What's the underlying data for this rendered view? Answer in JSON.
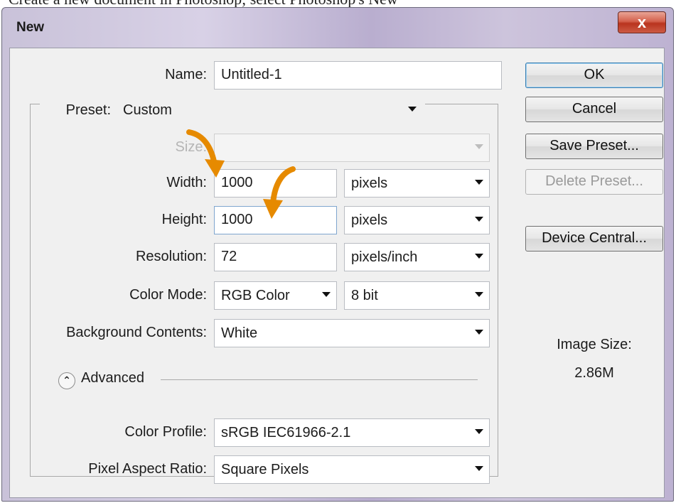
{
  "header_text": "Create a new document in Photoshop; select Photoshop's New",
  "window": {
    "title": "New",
    "close_glyph": "x"
  },
  "form": {
    "name": {
      "label": "Name:",
      "value": "Untitled-1"
    },
    "preset": {
      "label": "Preset:",
      "value": "Custom"
    },
    "size": {
      "label": "Size:",
      "value": ""
    },
    "width": {
      "label": "Width:",
      "value": "1000",
      "unit": "pixels"
    },
    "height": {
      "label": "Height:",
      "value": "1000",
      "unit": "pixels"
    },
    "resolution": {
      "label": "Resolution:",
      "value": "72",
      "unit": "pixels/inch"
    },
    "color_mode": {
      "label": "Color Mode:",
      "value": "RGB Color",
      "depth": "8 bit"
    },
    "background": {
      "label": "Background Contents:",
      "value": "White"
    },
    "advanced": {
      "label": "Advanced",
      "icon": "chevron-up-icon"
    },
    "color_profile": {
      "label": "Color Profile:",
      "value": "sRGB IEC61966-2.1"
    },
    "pixel_aspect": {
      "label": "Pixel Aspect Ratio:",
      "value": "Square Pixels"
    }
  },
  "buttons": {
    "ok": "OK",
    "cancel": "Cancel",
    "save_preset": "Save Preset...",
    "delete_preset": "Delete Preset...",
    "device_central": "Device Central..."
  },
  "image_size": {
    "label": "Image Size:",
    "value": "2.86M"
  },
  "colors": {
    "annotation_arrow": "#e68a00",
    "close_button": "#c9432d"
  }
}
